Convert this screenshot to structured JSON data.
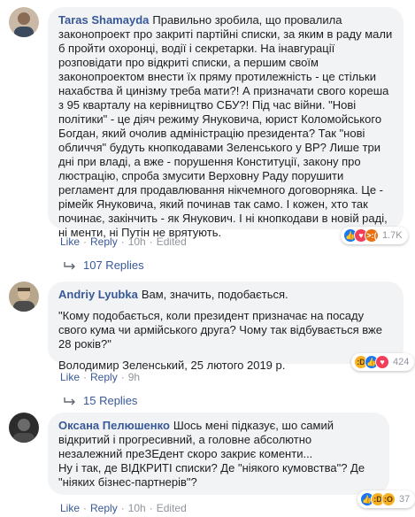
{
  "comments": [
    {
      "author": "Taras Shamayda",
      "paragraphs": [
        "Правильно зробила, що провалила законопроект про закриті партійні списки, за яким в раду мали б пройти охоронці, водії і секретарки. На інавгурації розповідати про відкриті списки, а першим своїм законопроектом внести їх пряму протилежність - це стільки нахабства й цинізму треба мати?! А призначати свого кореша з 95 кварталу на керівництво СБУ?! Під час війни. \"Нові політики\" - це діяч режиму Януковича, юрист Коломойського Богдан, який очолив адміністрацію президента? Так \"нові обличчя\" будуть кнопкодавами Зеленського у ВР? Лише три дні при владі, а вже - порушення Конституції, закону про люстрацію, спроба змусити Верховну Раду порушити регламент для продавлювання нікчемного договорняка. Це - рімейк Януковича, який починав так само. І кожен, хто так починає, закінчить - як Янукович. І ні кнопкодави в новій раді, ні менти, ні Путін не врятують."
      ],
      "actions": {
        "like": "Like",
        "reply": "Reply",
        "time": "10h",
        "edited": "Edited"
      },
      "reactions": {
        "icons": [
          "like",
          "love",
          "angry"
        ],
        "count": "1.7K"
      },
      "replies": "107 Replies"
    },
    {
      "author": "Andriy Lyubka",
      "paragraphs": [
        "Вам, значить, подобається.",
        "\"Кому подобається, коли президент призначає на посаду свого кума чи армійського друга? Чому так відбувається вже 28 років?\"",
        "Володимир Зеленський, 25 лютого 2019 р."
      ],
      "actions": {
        "like": "Like",
        "reply": "Reply",
        "time": "9h",
        "edited": ""
      },
      "reactions": {
        "icons": [
          "haha",
          "like",
          "love"
        ],
        "count": "424"
      },
      "replies": "15 Replies"
    },
    {
      "author": "Оксана Пелюшенко",
      "paragraphs": [
        "Шось мені підказує, шо самий відкритий і прогресивний, а головне абсолютно незалежний преЗЕдент скоро закриє коменти...",
        "Ну і так, де ВІДКРИТІ списки? Де \"ніякого кумовства\"? Де \"ніяких бізнес-партнерів\"?"
      ],
      "actions": {
        "like": "Like",
        "reply": "Reply",
        "time": "10h",
        "edited": "Edited"
      },
      "reactions": {
        "icons": [
          "like",
          "haha",
          "wow"
        ],
        "count": "37"
      }
    }
  ],
  "colors": {
    "link": "#385898",
    "bubble": "#f2f3f5",
    "meta": "#90949c"
  }
}
